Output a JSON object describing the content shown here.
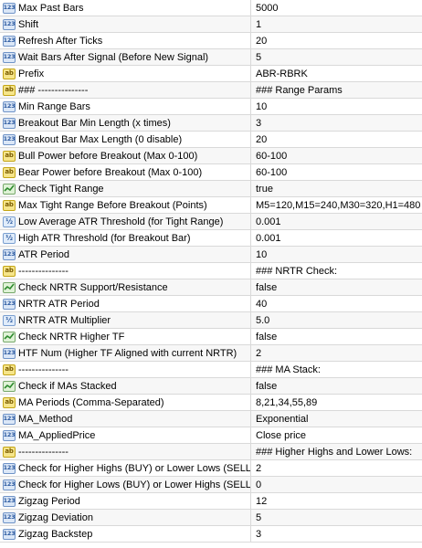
{
  "parameters": [
    {
      "name": "Max Past Bars",
      "value": "5000",
      "icon": "int-icon"
    },
    {
      "name": "Shift",
      "value": "1",
      "icon": "int-icon"
    },
    {
      "name": "Refresh After Ticks",
      "value": "20",
      "icon": "int-icon"
    },
    {
      "name": "Wait Bars After Signal (Before New Signal)",
      "value": "5",
      "icon": "int-icon"
    },
    {
      "name": "Prefix",
      "value": "ABR-RBRK",
      "icon": "string-icon"
    },
    {
      "name": "### ---------------",
      "value": "### Range Params",
      "icon": "string-icon"
    },
    {
      "name": "Min Range Bars",
      "value": "10",
      "icon": "int-icon"
    },
    {
      "name": "Breakout Bar Min Length (x times)",
      "value": "3",
      "icon": "int-icon"
    },
    {
      "name": "Breakout Bar Max Length (0 disable)",
      "value": "20",
      "icon": "int-icon"
    },
    {
      "name": "Bull Power before Breakout (Max 0-100)",
      "value": "60-100",
      "icon": "string-icon"
    },
    {
      "name": "Bear Power before Breakout (Max 0-100)",
      "value": "60-100",
      "icon": "string-icon"
    },
    {
      "name": "Check Tight Range",
      "value": "true",
      "icon": "bool-icon"
    },
    {
      "name": "Max Tight Range Before Breakout (Points)",
      "value": "M5=120,M15=240,M30=320,H1=480",
      "icon": "string-icon"
    },
    {
      "name": "Low Average ATR Threshold (for Tight Range)",
      "value": "0.001",
      "icon": "double-icon"
    },
    {
      "name": "High ATR Threshold (for Breakout Bar)",
      "value": "0.001",
      "icon": "double-icon"
    },
    {
      "name": "ATR Period",
      "value": "10",
      "icon": "int-icon"
    },
    {
      "name": "---------------",
      "value": "### NRTR Check:",
      "icon": "string-icon"
    },
    {
      "name": "Check NRTR Support/Resistance",
      "value": "false",
      "icon": "bool-icon"
    },
    {
      "name": "NRTR ATR Period",
      "value": "40",
      "icon": "int-icon"
    },
    {
      "name": "NRTR ATR Multiplier",
      "value": "5.0",
      "icon": "double-icon"
    },
    {
      "name": "Check NRTR Higher TF",
      "value": "false",
      "icon": "bool-icon"
    },
    {
      "name": "HTF Num (Higher TF Aligned with current NRTR)",
      "value": "2",
      "icon": "int-icon"
    },
    {
      "name": "---------------",
      "value": "### MA Stack:",
      "icon": "string-icon"
    },
    {
      "name": "Check if MAs Stacked",
      "value": "false",
      "icon": "bool-icon"
    },
    {
      "name": "MA Periods (Comma-Separated)",
      "value": "8,21,34,55,89",
      "icon": "string-icon"
    },
    {
      "name": "MA_Method",
      "value": "Exponential",
      "icon": "int-icon"
    },
    {
      "name": "MA_AppliedPrice",
      "value": "Close price",
      "icon": "int-icon"
    },
    {
      "name": "---------------",
      "value": "### Higher Highs and Lower Lows:",
      "icon": "string-icon"
    },
    {
      "name": "Check for Higher Highs (BUY) or Lower Lows (SELL)",
      "value": "2",
      "icon": "int-icon"
    },
    {
      "name": "Check for Higher Lows (BUY) or Lower Highs (SELL)",
      "value": "0",
      "icon": "int-icon"
    },
    {
      "name": "Zigzag Period",
      "value": "12",
      "icon": "int-icon"
    },
    {
      "name": "Zigzag Deviation",
      "value": "5",
      "icon": "int-icon"
    },
    {
      "name": "Zigzag Backstep",
      "value": "3",
      "icon": "int-icon"
    }
  ]
}
